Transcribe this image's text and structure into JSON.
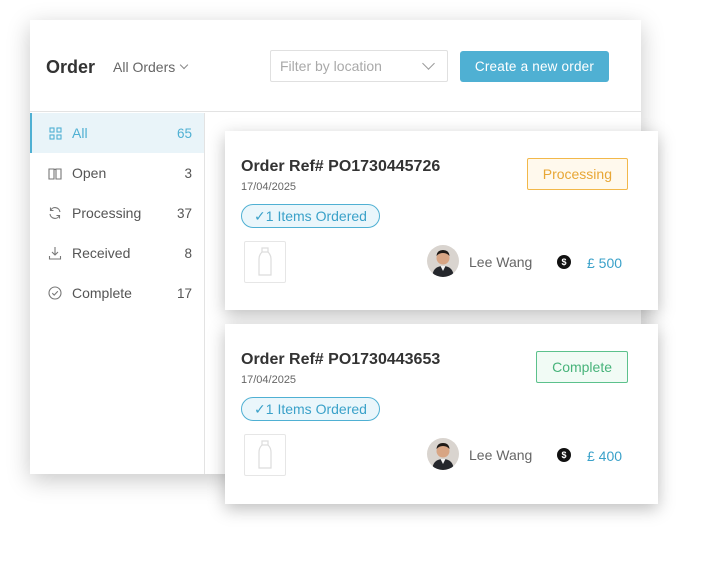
{
  "header": {
    "title": "Order",
    "filter_label": "All Orders",
    "location_placeholder": "Filter by location",
    "create_button": "Create a new order"
  },
  "sidebar": {
    "items": [
      {
        "label": "All",
        "count": "65",
        "icon": "grid-icon",
        "active": true
      },
      {
        "label": "Open",
        "count": "3",
        "icon": "book-icon",
        "active": false
      },
      {
        "label": "Processing",
        "count": "37",
        "icon": "refresh-icon",
        "active": false
      },
      {
        "label": "Received",
        "count": "8",
        "icon": "download-icon",
        "active": false
      },
      {
        "label": "Complete",
        "count": "17",
        "icon": "check-circle-icon",
        "active": false
      }
    ]
  },
  "orders": [
    {
      "ref": "Order Ref# PO1730445726",
      "date": "17/04/2025",
      "items": "1 Items Ordered",
      "status": "Processing",
      "person": "Lee Wang",
      "currency_symbol": "$",
      "amount": "£ 500"
    },
    {
      "ref": "Order Ref# PO1730443653",
      "date": "17/04/2025",
      "items": "1 Items Ordered",
      "status": "Complete",
      "person": "Lee Wang",
      "currency_symbol": "$",
      "amount": "£ 400"
    }
  ],
  "colors": {
    "accent": "#4fb0d3",
    "processing": "#e8a736",
    "complete": "#47b37a"
  }
}
